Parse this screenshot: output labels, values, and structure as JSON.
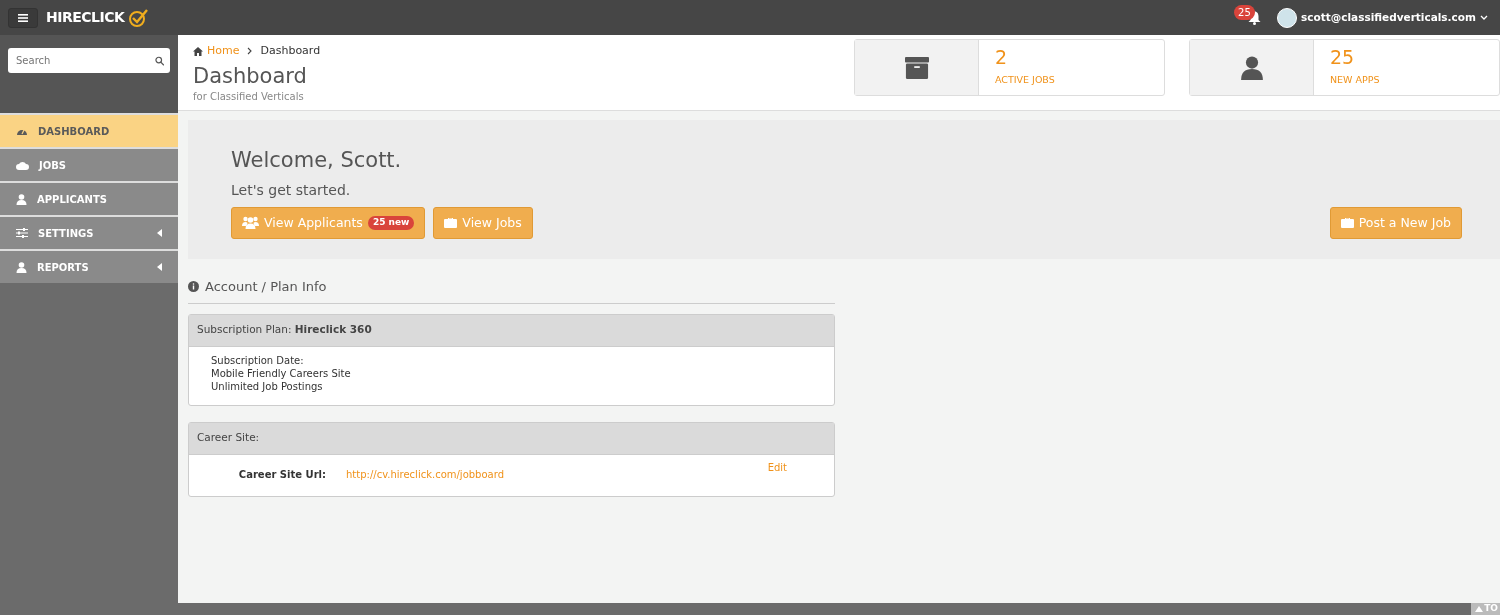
{
  "topbar": {
    "logo": "HIRECLICK",
    "notification_count": "25",
    "user_email": "scott@classifiedverticals.com"
  },
  "sidebar": {
    "search": {
      "placeholder": "Search"
    },
    "items": [
      {
        "label": "DASHBOARD",
        "selected": true,
        "submenu": false
      },
      {
        "label": "JOBS",
        "selected": false,
        "submenu": false
      },
      {
        "label": "APPLICANTS",
        "selected": false,
        "submenu": false
      },
      {
        "label": "SETTINGS",
        "selected": false,
        "submenu": true
      },
      {
        "label": "REPORTS",
        "selected": false,
        "submenu": true
      }
    ]
  },
  "breadcrumb": [
    {
      "label": "Home",
      "link": true
    },
    {
      "label": "Dashboard",
      "link": false
    }
  ],
  "page": {
    "title": "Dashboard",
    "subtitle": "for Classified Verticals"
  },
  "stats": [
    {
      "value": "2",
      "label": "ACTIVE JOBS"
    },
    {
      "value": "25",
      "label": "NEW APPS"
    }
  ],
  "welcome": {
    "title": "Welcome, Scott.",
    "subtitle": "Let's get started.",
    "buttons": [
      {
        "label": "View Applicants",
        "badge": "25 new"
      },
      {
        "label": "View Jobs"
      }
    ],
    "right_button": {
      "label": "Post a New Job"
    }
  },
  "account": {
    "heading": "Account / Plan Info",
    "plan_panel": {
      "header": "Subscription Plan: **Hireclick 360**",
      "lines": [
        "Subscription Date:",
        "Mobile Friendly Careers Site",
        "Unlimited Job Postings"
      ]
    },
    "career_panel": {
      "header": "Career Site:",
      "field_label": "Career Site Url:",
      "url": "http://cv.hireclick.com/jobboard",
      "edit": "Edit"
    }
  },
  "back_to_top": "TO"
}
